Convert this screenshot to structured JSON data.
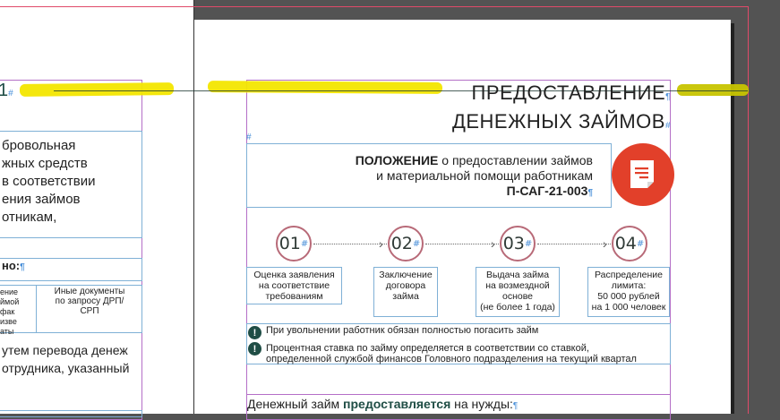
{
  "left_page": {
    "heading_fragment": "1",
    "para_lines": [
      "бровольная",
      "жных средств",
      "в соответствии",
      "ения займов",
      "отникам,"
    ],
    "bold_label": "но:",
    "table_left_lines": [
      "ение",
      "ймой",
      "фак",
      "изве",
      "аты"
    ],
    "table_right_lines": [
      "Иные документы",
      "по запросу ДРП/",
      "СРП"
    ],
    "bottom_lines": [
      "утем перевода денеж",
      "отрудника, указанный"
    ]
  },
  "right_page": {
    "title_line1": "ПРЕДОСТАВЛЕНИЕ",
    "title_line2": "ДЕНЕЖНЫХ ЗАЙМОВ",
    "regulation": {
      "bold_word": "ПОЛОЖЕНИЕ",
      "line1_rest": " о предоставлении займов",
      "line2": "и материальной помощи работникам",
      "code": "П-САГ-21-003"
    },
    "steps": [
      {
        "num": "01",
        "lines": [
          "Оценка заявления",
          "на соответствие",
          "требованиям"
        ]
      },
      {
        "num": "02",
        "lines": [
          "Заключение",
          "договора",
          "займа"
        ]
      },
      {
        "num": "03",
        "lines": [
          "Выдача займа",
          "на возмездной",
          "основе",
          "(не более 1 года)"
        ]
      },
      {
        "num": "04",
        "lines": [
          "Распределение",
          "лимита:",
          "50 000 рублей",
          "на 1 000 человек"
        ]
      }
    ],
    "notes": [
      "При увольнении работник обязан полностью погасить займ",
      "Процентная ставка по займу определяется в соответствии со ставкой,",
      "определенной службой финансов Головного подразделения на текущий квартал"
    ],
    "footer_prefix": "Денежный займ ",
    "footer_bold": "предоставляется",
    "footer_suffix": " на нужды:"
  },
  "icons": {
    "document_badge_color": "#e2402a",
    "warning_color": "#1f4d45"
  }
}
